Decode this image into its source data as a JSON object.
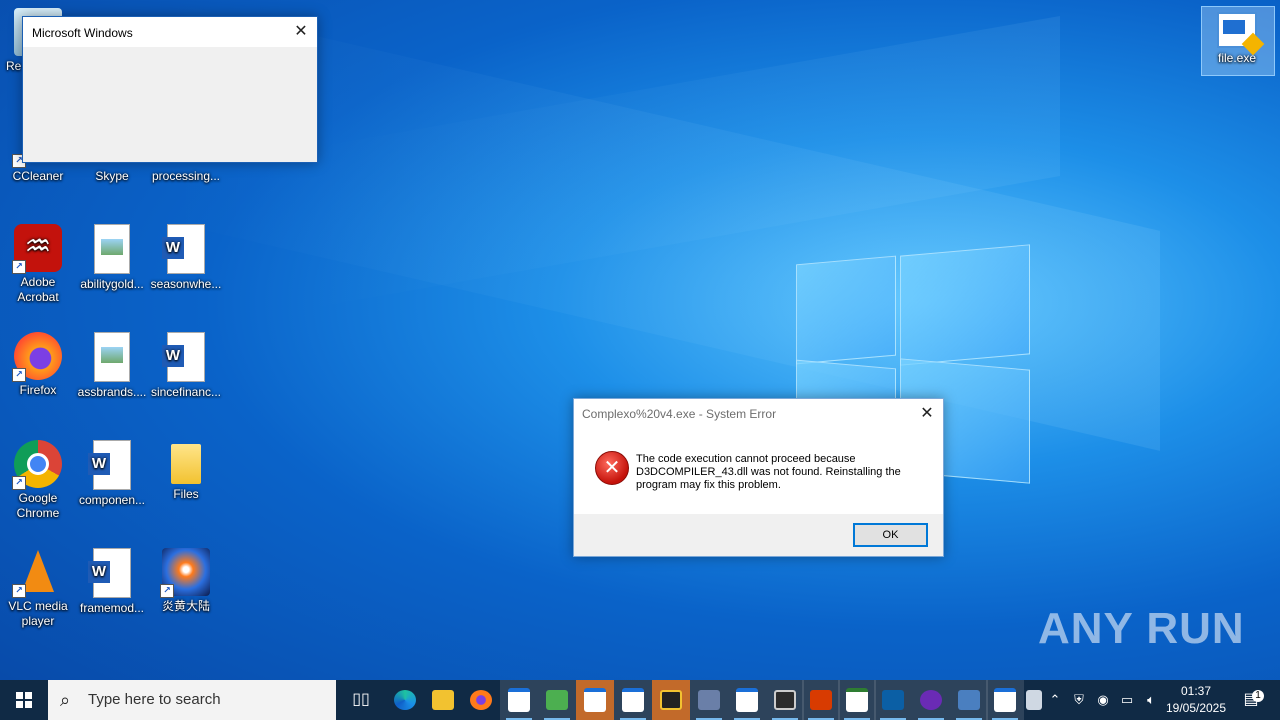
{
  "desktop_icons": [
    {
      "label": "Re",
      "kind": "recycle"
    },
    {
      "label": "CCleaner",
      "kind": "ccleaner"
    },
    {
      "label": "Skype",
      "kind": "skype"
    },
    {
      "label": "processing...",
      "kind": "doc"
    },
    {
      "label": "Adobe Acrobat",
      "kind": "acrobat"
    },
    {
      "label": "abilitygold...",
      "kind": "image"
    },
    {
      "label": "seasonwhe...",
      "kind": "word"
    },
    {
      "label": "Firefox",
      "kind": "firefox"
    },
    {
      "label": "assbrands....",
      "kind": "image"
    },
    {
      "label": "sincefinanc...",
      "kind": "word"
    },
    {
      "label": "Google Chrome",
      "kind": "chrome"
    },
    {
      "label": "componen...",
      "kind": "word"
    },
    {
      "label": "Files",
      "kind": "folder"
    },
    {
      "label": "VLC media player",
      "kind": "vlc"
    },
    {
      "label": "framemod...",
      "kind": "word"
    },
    {
      "label": "炎黄大陆",
      "kind": "game"
    },
    {
      "label": "file.exe",
      "kind": "exe"
    }
  ],
  "ms_windows_dialog": {
    "title": "Microsoft Windows",
    "close_glyph": "✕"
  },
  "error_dialog": {
    "title": "Complexo%20v4.exe - System Error",
    "close_glyph": "✕",
    "icon": "error-icon",
    "message": "The code execution cannot proceed because D3DCOMPILER_43.dll was not found. Reinstalling the program may fix this problem.",
    "ok_label": "OK"
  },
  "watermark": "ANY RUN",
  "taskbar": {
    "search_placeholder": "Type here to search",
    "time": "01:37",
    "date": "19/05/2025",
    "notification_count": "1",
    "colors": {
      "bar": "#102a45",
      "accent": "#76b9ed",
      "highlight": "#c26a2a"
    }
  }
}
